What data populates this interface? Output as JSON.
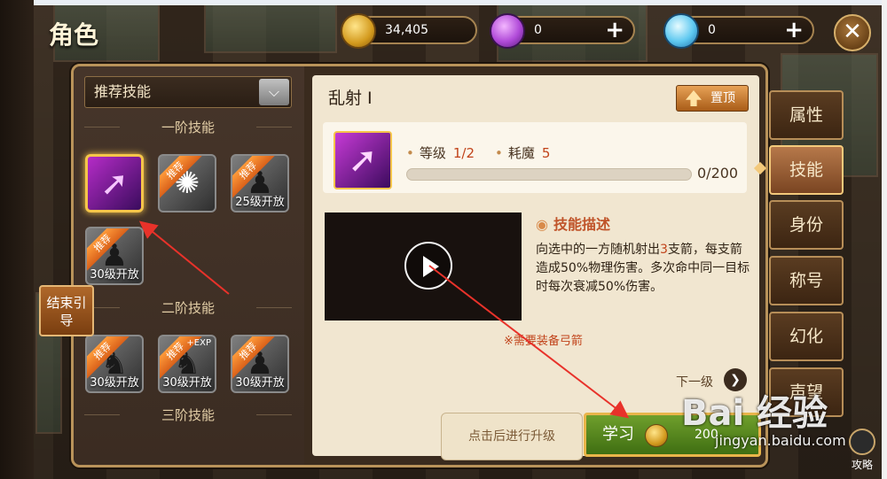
{
  "header": {
    "title": "角色"
  },
  "currencies": [
    {
      "icon": "gold-coin-icon",
      "value": "34,405",
      "has_plus": false
    },
    {
      "icon": "purple-gem-icon",
      "value": "0",
      "has_plus": true
    },
    {
      "icon": "diamond-icon",
      "value": "0",
      "has_plus": true
    }
  ],
  "close_label": "✕",
  "left_panel": {
    "dropdown_label": "推荐技能",
    "tiers": [
      "一阶技能",
      "二阶技能",
      "三阶技能"
    ],
    "skills_tier1": [
      {
        "ribbon": "",
        "lock": ""
      },
      {
        "ribbon": "推荐",
        "lock": ""
      },
      {
        "ribbon": "推荐",
        "lock": "25级开放"
      },
      {
        "ribbon": "推荐",
        "lock": "30级开放"
      }
    ],
    "skills_tier2": [
      {
        "ribbon": "推荐",
        "lock": "30级开放"
      },
      {
        "ribbon": "推荐",
        "lock": "30级开放",
        "tag": "+EXP"
      },
      {
        "ribbon": "推荐",
        "lock": "30级开放"
      }
    ],
    "end_guide": "结束引导"
  },
  "detail": {
    "skill_name": "乱射 I",
    "pin_label": "置顶",
    "level_label": "等级",
    "level_value": "1/2",
    "mana_label": "耗魔",
    "mana_value": "5",
    "progress_text": "0/200",
    "progress_fraction": 0,
    "desc_title": "技能描述",
    "desc_prefix": "向选中的一方随机射出",
    "desc_highlight": "3",
    "desc_suffix": "支箭，每支箭造成50%物理伤害。多次命中同一目标时每次衰减50%伤害。",
    "requirement": "※需要装备弓箭",
    "next_level": "下一级"
  },
  "tabs": [
    "属性",
    "技能",
    "身份",
    "称号",
    "幻化",
    "声望"
  ],
  "active_tab": 1,
  "actions": {
    "hint": "点击后进行升级",
    "learn_label": "学习",
    "learn_cost": "200"
  },
  "strategy_label": "攻略",
  "watermark": {
    "logo": "Bai 经验",
    "url": "jingyan.baidu.com"
  },
  "colors": {
    "accent": "#c1431a",
    "frame": "#b9935a",
    "learn_green": "#4f8a1c"
  }
}
